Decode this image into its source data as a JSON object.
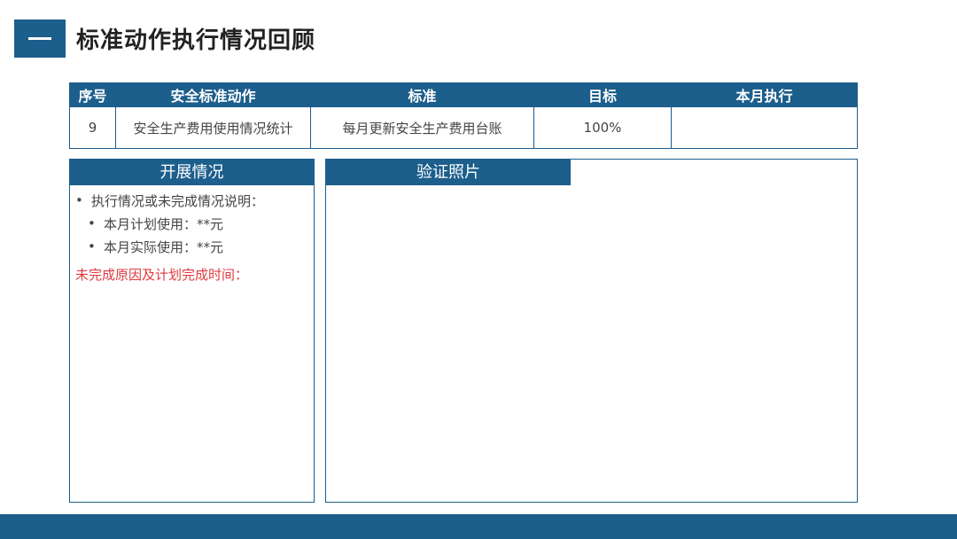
{
  "header": {
    "badge_glyph": "一",
    "title": "标准动作执行情况回顾"
  },
  "table": {
    "columns": [
      "序号",
      "安全标准动作",
      "标准",
      "目标",
      "本月执行"
    ],
    "rows": [
      [
        "9",
        "安全生产费用使用情况统计",
        "每月更新安全生产费用台账",
        "100%",
        ""
      ]
    ]
  },
  "left_panel": {
    "title": "开展情况",
    "items": [
      "执行情况或未完成情况说明：",
      "本月计划使用：**元",
      "本月实际使用：**元"
    ],
    "red_text": "未完成原因及计划完成时间："
  },
  "right_panel": {
    "title": "验证照片"
  },
  "colors": {
    "primary": "#1c5e8c",
    "alert": "#e0393e"
  }
}
